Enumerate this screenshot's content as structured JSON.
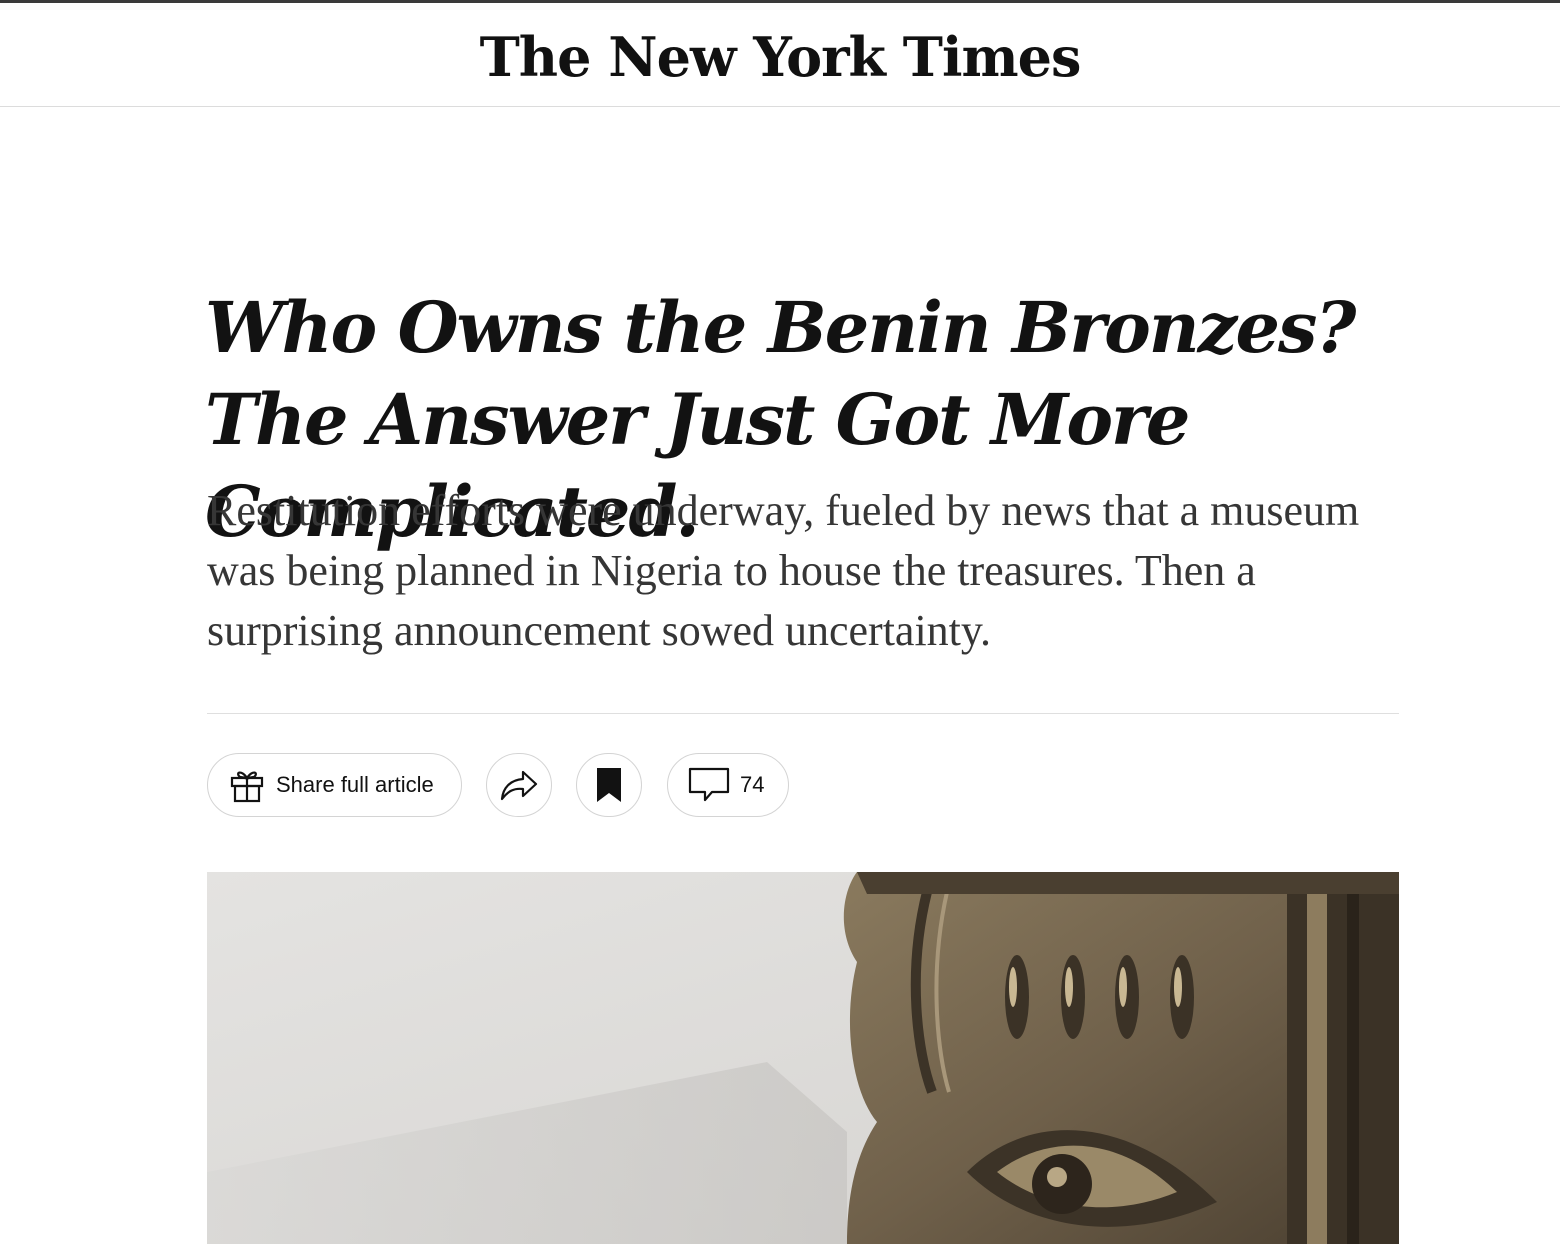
{
  "masthead": {
    "logo_text": "The New York Times"
  },
  "article": {
    "headline": "Who Owns the Benin Bronzes? The Answer Just Got More Complicated.",
    "summary": "Restitution efforts were underway, fueled by news that a museum was being planned in Nigeria to house the treasures. Then a surprising announcement sowed uncertainty."
  },
  "share_tools": {
    "share_label": "Share full article",
    "share_icon": "gift-icon",
    "forward_icon": "share-arrow-icon",
    "save_icon": "bookmark-icon",
    "comments_icon": "comment-bubble-icon",
    "comments_count": "74"
  },
  "hero_image": {
    "subject": "Benin bronze sculpture close-up"
  },
  "colors": {
    "text": "#121212",
    "summary_text": "#363636",
    "border": "#d4d4d4",
    "bronze": "#6e5f45"
  }
}
